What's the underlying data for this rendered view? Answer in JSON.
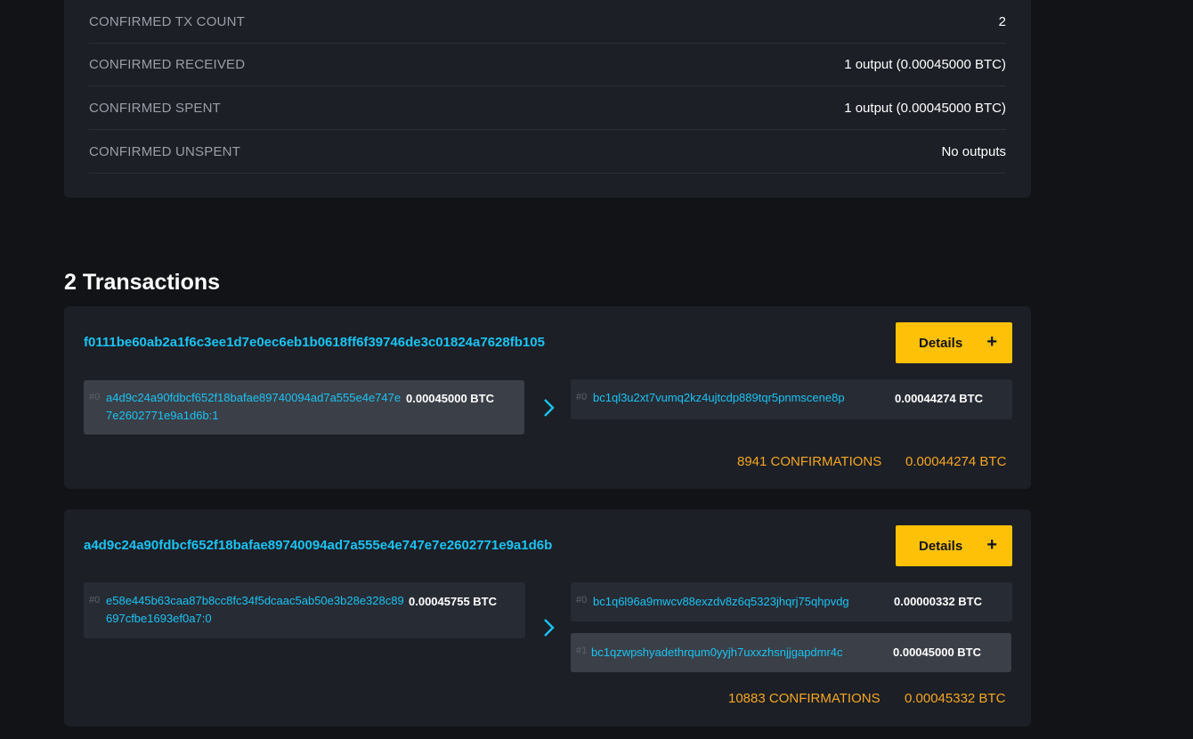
{
  "summary": {
    "rows": [
      {
        "label": "CONFIRMED TX COUNT",
        "value": "2"
      },
      {
        "label": "CONFIRMED RECEIVED",
        "value": "1 output (0.00045000 BTC)"
      },
      {
        "label": "CONFIRMED SPENT",
        "value": "1 output (0.00045000 BTC)"
      },
      {
        "label": "CONFIRMED UNSPENT",
        "value": "No outputs"
      }
    ]
  },
  "transactions_title": "2 Transactions",
  "transactions": [
    {
      "txid": "f0111be60ab2a1f6c3ee1d7e0ec6eb1b0618ff6f39746de3c01824a7628fb105",
      "details_label": "Details",
      "details_icon": "+",
      "inputs": [
        {
          "index": "#0",
          "address": "a4d9c24a90fdbcf652f18bafae89740094ad7a555e4e747e7e2602771e9a1d6b:1",
          "amount": "0.00045000 BTC"
        }
      ],
      "outputs": [
        {
          "index": "#0",
          "address": "bc1ql3u2xt7vumq2kz4ujtcdp889tqr5pnmscene8p",
          "amount": "0.00044274 BTC"
        }
      ],
      "confirmations": "8941 CONFIRMATIONS",
      "total": "0.00044274 BTC"
    },
    {
      "txid": "a4d9c24a90fdbcf652f18bafae89740094ad7a555e4e747e7e2602771e9a1d6b",
      "details_label": "Details",
      "details_icon": "+",
      "inputs": [
        {
          "index": "#0",
          "address": "e58e445b63caa87b8cc8fc34f5dcaac5ab50e3b28e328c89697cfbe1693ef0a7:0",
          "amount": "0.00045755 BTC"
        }
      ],
      "outputs": [
        {
          "index": "#0",
          "address": "bc1q6l96a9mwcv88exzdv8z6q5323jhqrj75qhpvdg",
          "amount": "0.00000332 BTC"
        },
        {
          "index": "#1",
          "address": "bc1qzwpshyadethrqum0yyjh7uxxzhsnjjgapdmr4c",
          "amount": "0.00045000 BTC"
        }
      ],
      "confirmations": "10883 CONFIRMATIONS",
      "total": "0.00045332 BTC"
    }
  ],
  "colors": {
    "accent": "#1bc3f2",
    "button": "#ffc107",
    "confirm": "#f5a623"
  },
  "icons": {
    "arrow": "chevron-right-icon",
    "details": "plus-icon"
  }
}
